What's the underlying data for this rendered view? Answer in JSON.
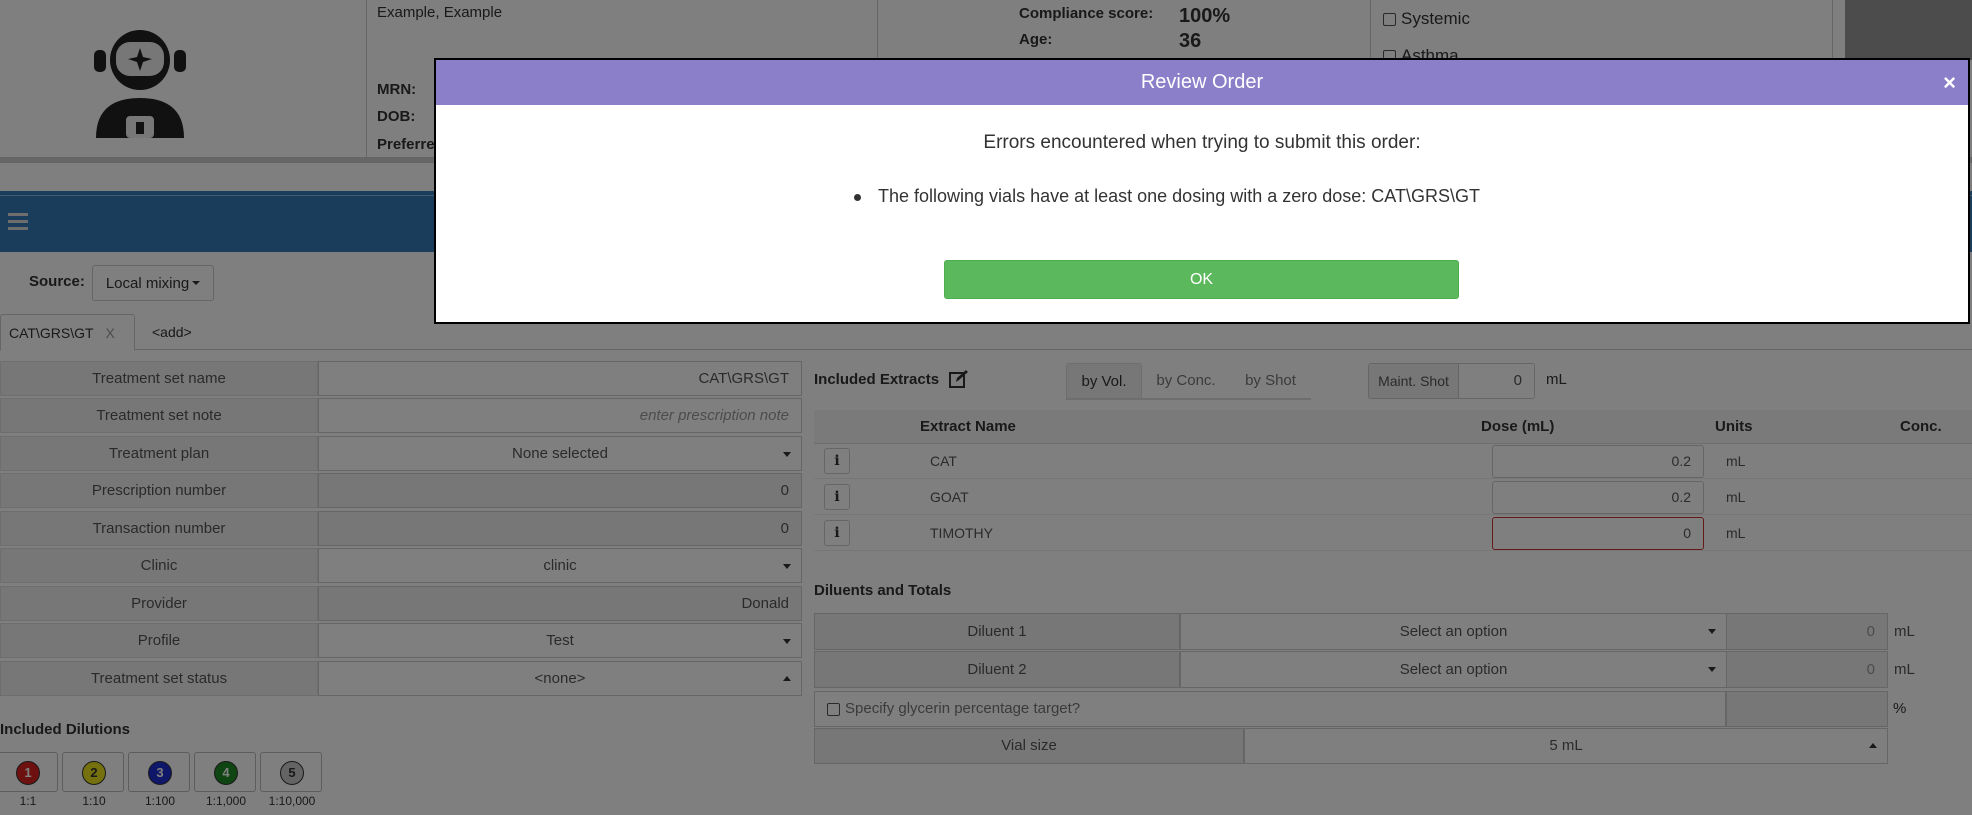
{
  "header": {
    "patient_name": "Example, Example",
    "mrn_label": "MRN:",
    "dob_label": "DOB:",
    "preferred_label": "Preferre",
    "compliance_label": "Compliance score:",
    "compliance_value": "100%",
    "age_label": "Age:",
    "age_value": "36",
    "checks": [
      "Systemic",
      "Asthma"
    ]
  },
  "source": {
    "label": "Source:",
    "value": "Local mixing"
  },
  "tabs": [
    {
      "label": "CAT\\GRS\\GT",
      "close": "X"
    },
    {
      "label": "<add>"
    }
  ],
  "form": [
    {
      "label": "Treatment set name",
      "value": "CAT\\GRS\\GT"
    },
    {
      "label": "Treatment set note",
      "placeholder": "enter prescription note"
    },
    {
      "label": "Treatment plan",
      "value": "None selected"
    },
    {
      "label": "Prescription number",
      "value": "0"
    },
    {
      "label": "Transaction number",
      "value": "0"
    },
    {
      "label": "Clinic",
      "value": "clinic"
    },
    {
      "label": "Provider",
      "value": "Donald"
    },
    {
      "label": "Profile",
      "value": "Test"
    },
    {
      "label": "Treatment set status",
      "value": "<none>"
    }
  ],
  "dilutions": {
    "title": "Included Dilutions",
    "items": [
      {
        "num": "1",
        "ratio": "1:1",
        "color": "#d9231f"
      },
      {
        "num": "2",
        "ratio": "1:10",
        "color": "#e8e21c"
      },
      {
        "num": "3",
        "ratio": "1:100",
        "color": "#1e2fd1"
      },
      {
        "num": "4",
        "ratio": "1:1,000",
        "color": "#1f8a24"
      },
      {
        "num": "5",
        "ratio": "1:10,000",
        "color": "#c8c8c8"
      }
    ]
  },
  "extracts": {
    "title": "Included Extracts",
    "modes": [
      "by Vol.",
      "by Conc.",
      "by Shot"
    ],
    "maint_label": "Maint. Shot",
    "maint_value": "0",
    "maint_unit": "mL",
    "columns": [
      "Extract Name",
      "Dose (mL)",
      "Units",
      "Conc."
    ],
    "rows": [
      {
        "info": "i",
        "name": "CAT",
        "dose": "0.2",
        "unit": "mL"
      },
      {
        "info": "i",
        "name": "GOAT",
        "dose": "0.2",
        "unit": "mL"
      },
      {
        "info": "i",
        "name": "TIMOTHY",
        "dose": "0",
        "unit": "mL"
      }
    ]
  },
  "diluents": {
    "title": "Diluents and Totals",
    "rows": [
      {
        "label": "Diluent 1",
        "select": "Select an option",
        "value": "0",
        "unit": "mL"
      },
      {
        "label": "Diluent 2",
        "select": "Select an option",
        "value": "0",
        "unit": "mL"
      }
    ],
    "glycerin_label": "Specify glycerin percentage target?",
    "glycerin_unit": "%",
    "vial_label": "Vial size",
    "vial_value": "5 mL"
  },
  "modal": {
    "title": "Review Order",
    "close": "×",
    "message": "Errors encountered when trying to submit this order:",
    "error": "The following vials have at least one dosing with a zero dose: CAT\\GRS\\GT",
    "ok": "OK"
  }
}
